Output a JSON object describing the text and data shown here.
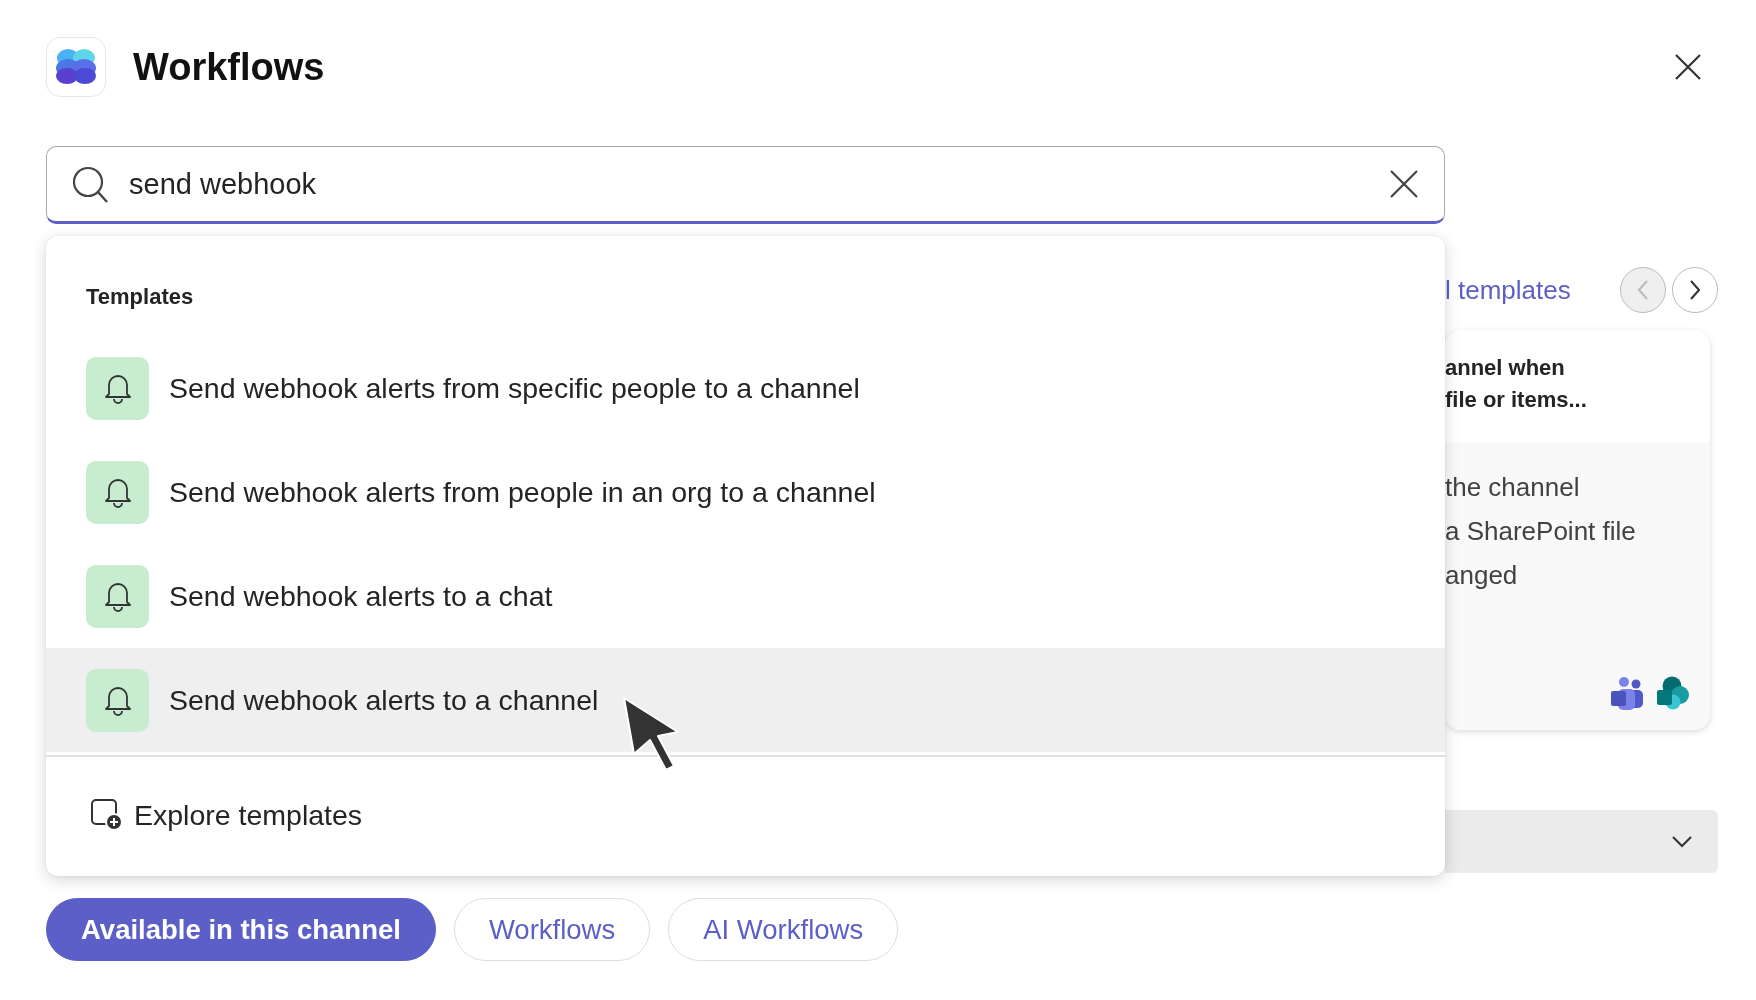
{
  "app": {
    "title": "Workflows"
  },
  "search": {
    "value": "send webhook"
  },
  "dropdown": {
    "section": "Templates",
    "items": [
      {
        "label": "Send webhook alerts from specific people to a channel",
        "selected": false
      },
      {
        "label": "Send webhook alerts from people in an org to a channel",
        "selected": false
      },
      {
        "label": "Send webhook alerts to a chat",
        "selected": false
      },
      {
        "label": "Send webhook alerts to a channel",
        "selected": true
      }
    ],
    "footer": "Explore templates"
  },
  "background": {
    "link": "l templates",
    "nav": [
      {
        "kind": "prev",
        "disabled": true
      },
      {
        "kind": "next",
        "disabled": false
      }
    ],
    "card": {
      "title_lines": [
        "annel when",
        "file or items..."
      ],
      "body_lines": [
        "the channel",
        "a SharePoint file",
        "anged"
      ]
    }
  },
  "filters": [
    {
      "label": "Available in this channel",
      "selected": true
    },
    {
      "label": "Workflows",
      "selected": false
    },
    {
      "label": "AI Workflows",
      "selected": false
    }
  ]
}
